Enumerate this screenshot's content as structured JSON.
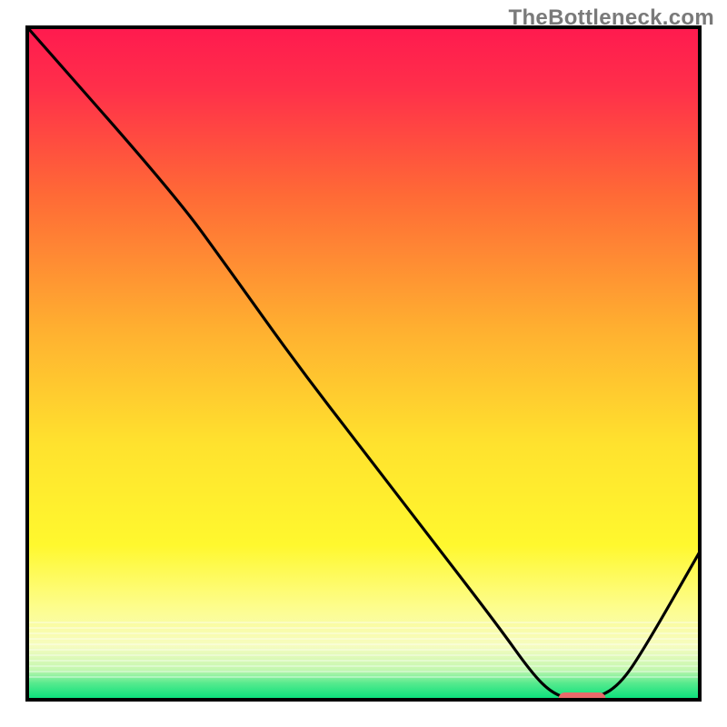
{
  "watermark": "TheBottleneck.com",
  "colors": {
    "red_top": "#ff1a4f",
    "orange_mid": "#ff8a2a",
    "yellow": "#ffef2e",
    "pale_yellow": "#fffabf",
    "green": "#04e07a",
    "curve": "#000000",
    "marker": "#e96a6a",
    "frame": "#000000"
  },
  "chart_data": {
    "type": "line",
    "title": "",
    "xlabel": "",
    "ylabel": "",
    "xlim": [
      0,
      100
    ],
    "ylim": [
      0,
      100
    ],
    "legend": false,
    "grid": false,
    "background_gradient": [
      "red",
      "orange",
      "yellow",
      "green"
    ],
    "series": [
      {
        "name": "bottleneck-curve",
        "x": [
          0,
          22,
          30,
          40,
          50,
          60,
          70,
          75,
          78,
          81,
          84,
          88,
          92,
          100
        ],
        "values": [
          100,
          75,
          64,
          50,
          37,
          24,
          11,
          4,
          1,
          0,
          0,
          2,
          8,
          22
        ]
      }
    ],
    "marker": {
      "x_start": 79,
      "x_end": 86,
      "y": 0,
      "label": "optimal-range"
    }
  }
}
